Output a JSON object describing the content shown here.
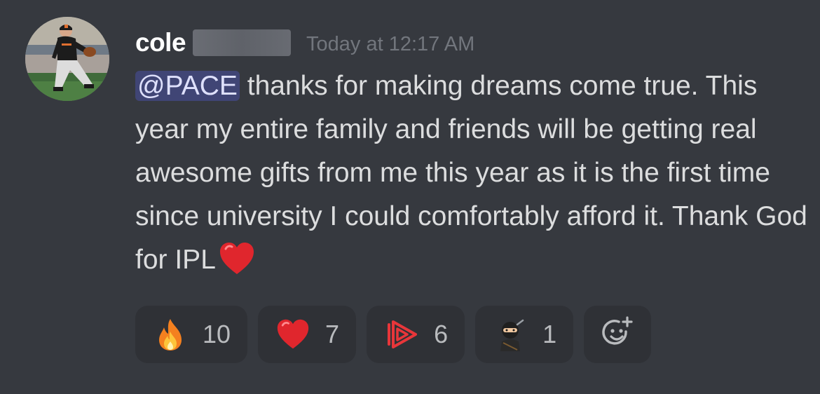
{
  "message": {
    "author": {
      "name": "cole",
      "name_redacted": true
    },
    "timestamp": "Today at 12:17 AM",
    "mention": "@PACE",
    "text": "thanks for making dreams come true. This year my entire family and friends will be getting real awesome gifts from me this year as it is the first time since university I could comfortably afford it. Thank God for IPL",
    "trailing_emoji": "red-heart-icon"
  },
  "reactions": [
    {
      "emoji": "fire-icon",
      "count": "10"
    },
    {
      "emoji": "red-heart-icon",
      "count": "7"
    },
    {
      "emoji": "pace-play-icon",
      "count": "6"
    },
    {
      "emoji": "ninja-icon",
      "count": "1"
    }
  ],
  "add_reaction": {
    "icon": "add-reaction-icon"
  },
  "colors": {
    "background": "#36393f",
    "reaction_bg": "#2f3136",
    "mention_bg": "#4a4f85",
    "mention_text": "#dee0fc",
    "timestamp": "#72767d",
    "heart": "#e0262d",
    "pace_red": "#e8363a"
  }
}
